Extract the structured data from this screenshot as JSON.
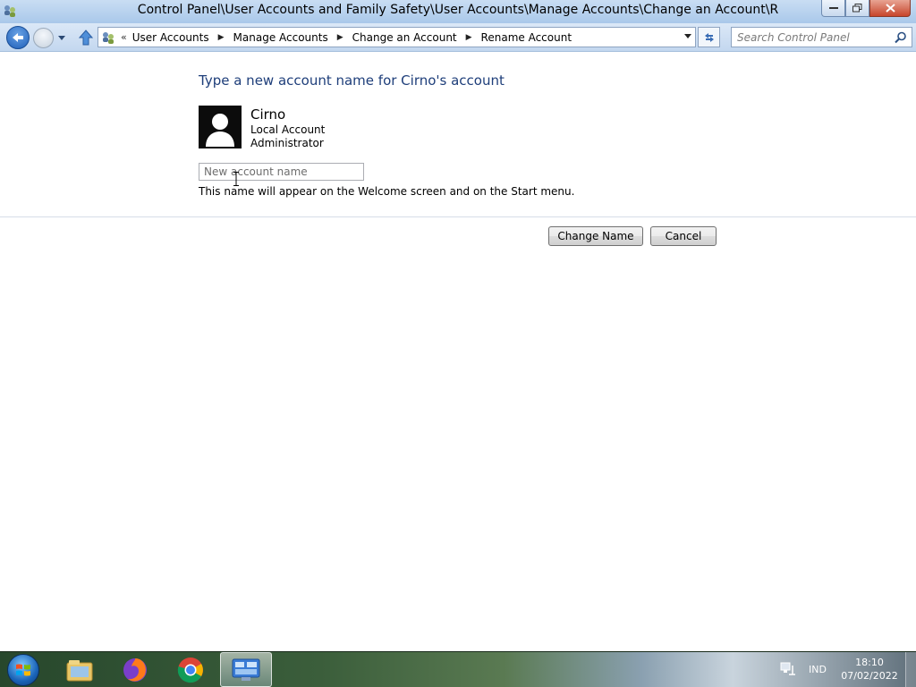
{
  "window": {
    "title": "Control Panel\\User Accounts and Family Safety\\User Accounts\\Manage Accounts\\Change an Account\\R"
  },
  "address_bar": {
    "breadcrumbs": [
      "User Accounts",
      "Manage Accounts",
      "Change an Account",
      "Rename Account"
    ],
    "overflow_chevron": "«"
  },
  "search": {
    "placeholder": "Search Control Panel"
  },
  "content": {
    "heading": "Type a new account name for Cirno's account",
    "account": {
      "name": "Cirno",
      "type": "Local Account",
      "role": "Administrator"
    },
    "new_name_input": {
      "placeholder": "New account name",
      "value": ""
    },
    "hint": "This name will appear on the Welcome screen and on the Start menu.",
    "change_name_button": "Change Name",
    "cancel_button": "Cancel"
  },
  "taskbar": {
    "apps": [
      "windows-explorer",
      "firefox",
      "chrome",
      "control-panel"
    ],
    "language": "IND",
    "time": "18:10",
    "date": "07/02/2022"
  },
  "colors": {
    "heading": "#1e3e7a",
    "titlebar": "#b9d1ee"
  }
}
